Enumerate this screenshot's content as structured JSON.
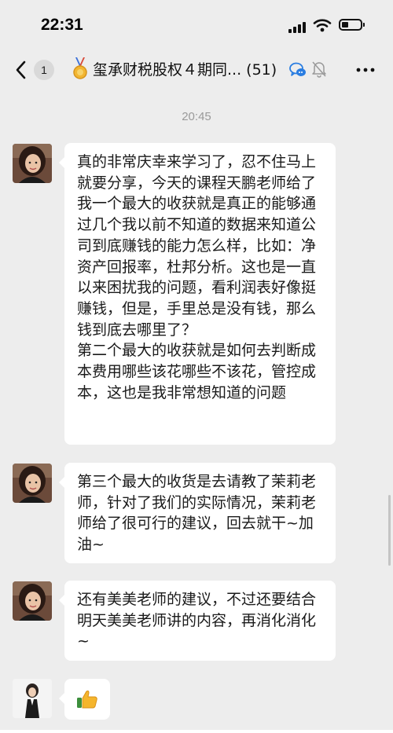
{
  "status_bar": {
    "time": "22:31"
  },
  "nav": {
    "back_label": "Back",
    "unread_count": "1",
    "title": "玺承财税股权４期同... (51)"
  },
  "chat": {
    "timestamp": "20:45",
    "messages": [
      {
        "text": "真的非常庆幸来学习了，忍不住马上就要分享，今天的课程天鹏老师给了我一个最大的收获就是真正的能够通过几个我以前不知道的数据来知道公司到底赚钱的能力怎么样，比如：净资产回报率，杜邦分析。这也是一直以来困扰我的问题，看利润表好像挺赚钱，但是，手里总是没有钱，那么钱到底去哪里了？\n第二个最大的收获就是如何去判断成本费用哪些该花哪些不该花，管控成本，这也是我非常想知道的问题"
      },
      {
        "text": "第三个最大的收货是去请教了茉莉老师，针对了我们的实际情况，茉莉老师给了很可行的建议，回去就干~加油~"
      },
      {
        "text": "还有美美老师的建议，不过还要结合明天美美老师讲的内容，再消化消化~"
      },
      {
        "emoji": "thumbs-up-icon"
      }
    ]
  },
  "colors": {
    "background": "#ededed",
    "bubble": "#ffffff",
    "timestamp": "#9a9a9a",
    "accent_blue": "#2a7de1"
  }
}
